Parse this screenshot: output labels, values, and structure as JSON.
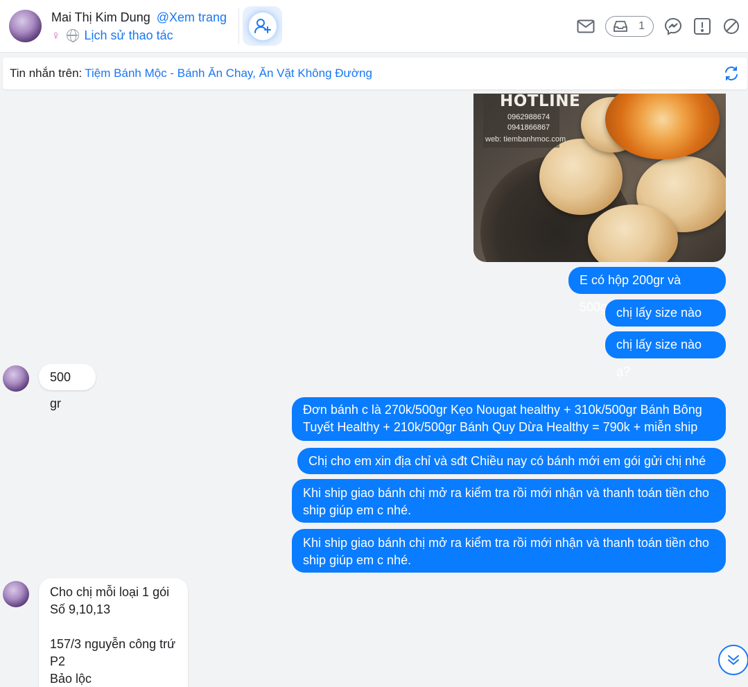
{
  "header": {
    "name": "Mai Thị Kim Dung",
    "view_page": "@Xem trang",
    "gender_symbol": "♀",
    "history_label": "Lịch sử thao tác",
    "inbox_count": "1"
  },
  "source_bar": {
    "label": "Tin nhắn trên:",
    "page_name": "Tiệm Bánh Mộc - Bánh Ăn Chay, Ăn Vặt Không Đường"
  },
  "photo": {
    "hotline": "HOTLINE",
    "phone1": "0962988674",
    "phone2": "0941866867",
    "web": "web: tiembanhmoc.com"
  },
  "messages": [
    {
      "side": "out",
      "text": "E có hộp 200gr và 500gr"
    },
    {
      "side": "out",
      "text": "chị lấy size nào ạ?"
    },
    {
      "side": "out",
      "text": "chị lấy size nào ạ?"
    },
    {
      "side": "in",
      "text": "500 gr"
    },
    {
      "side": "out",
      "line1": "Đơn bánh c là 270k/500gr Kẹo Nougat healthy + 310k/500gr Bánh Bông",
      "line2": "Tuyết Healthy + 210k/500gr Bánh Quy Dừa Healthy = 790k + miễn ship"
    },
    {
      "side": "out",
      "text": "Chị cho em xin địa chỉ và sđt Chiều nay có bánh mới em gói gửi chị nhé ạ"
    },
    {
      "side": "out",
      "line1": "Khi ship giao bánh chị mở ra kiểm tra rồi mới nhận và thanh toán tiền cho",
      "line2": "ship giúp em c nhé."
    },
    {
      "side": "out",
      "line1": "Khi ship giao bánh chị mở ra kiểm tra rồi mới nhận và thanh toán tiền cho",
      "line2": "ship giúp em c nhé."
    },
    {
      "side": "in",
      "lines": [
        "Cho chị mỗi loại 1 gói",
        "Số 9,10,13",
        "",
        "157/3 nguyễn công trứ",
        "P2",
        "Bảo lộc"
      ]
    }
  ],
  "colors": {
    "accent": "#1877f2",
    "outgoing_bubble": "#0a7cff",
    "background": "#f2f3f5"
  },
  "icons": [
    "add-friend-icon",
    "mail-icon",
    "inbox-icon",
    "messenger-icon",
    "report-icon",
    "block-icon",
    "refresh-icon",
    "scroll-down-icon"
  ]
}
